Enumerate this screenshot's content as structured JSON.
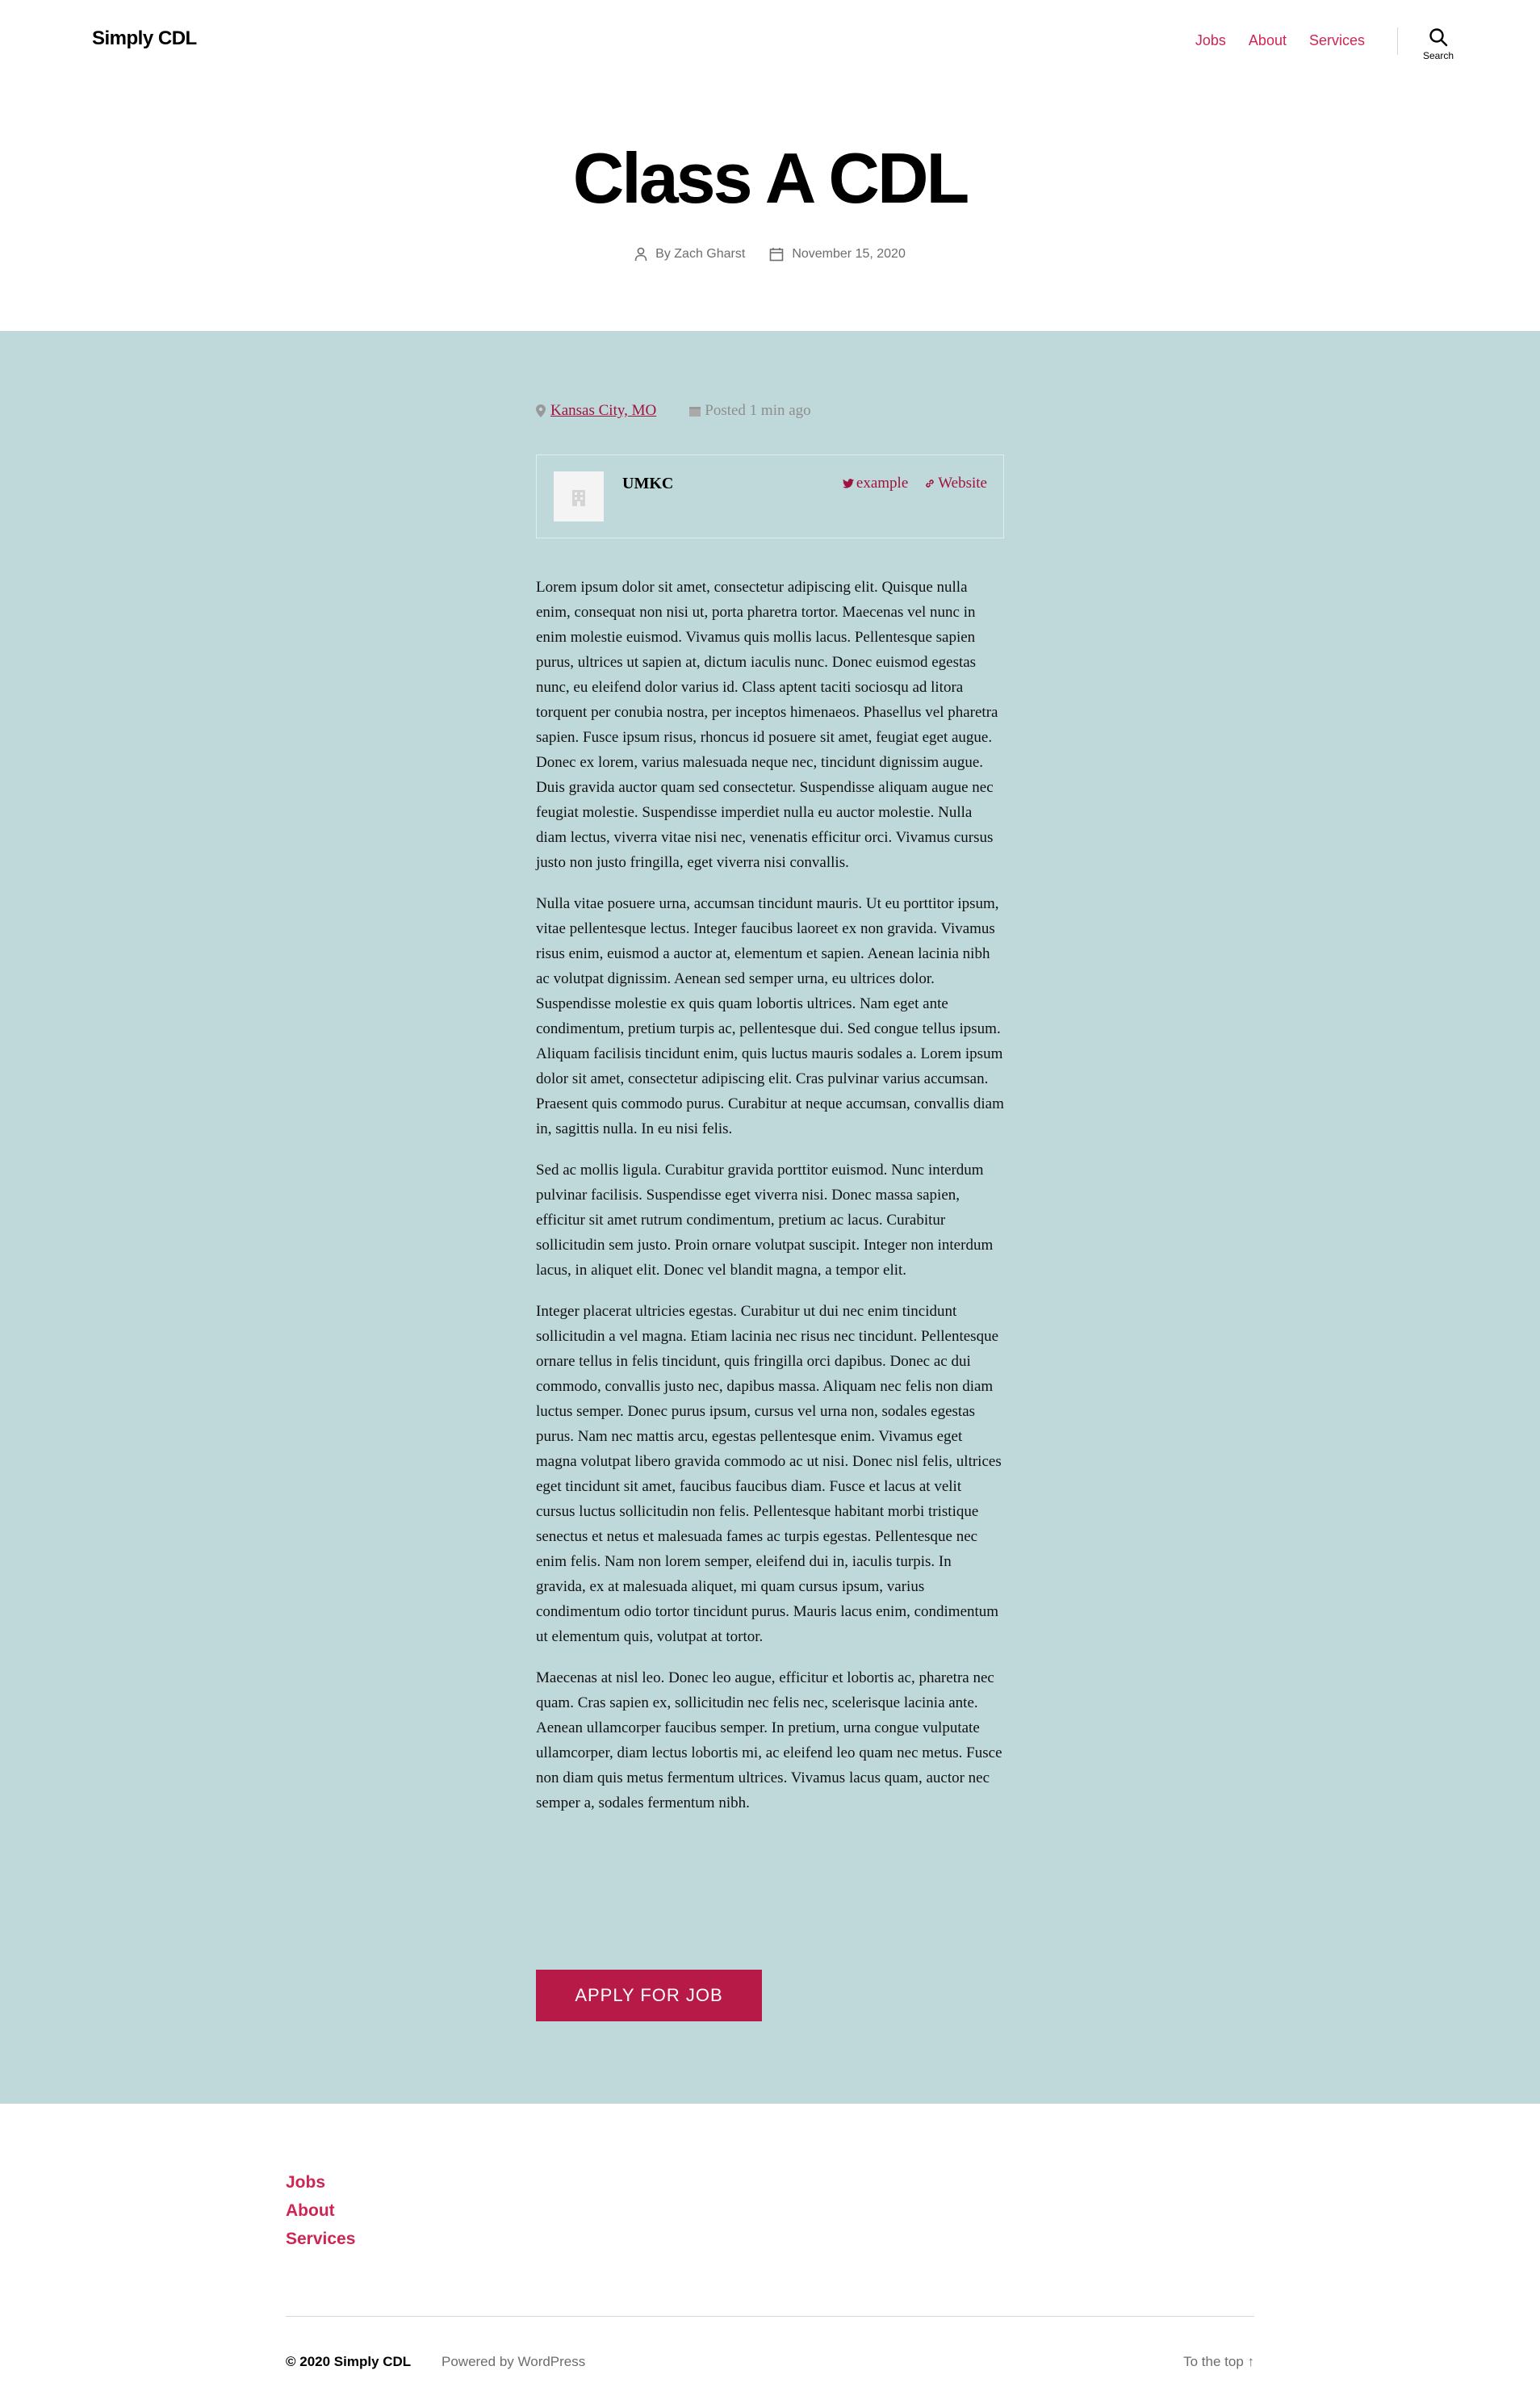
{
  "header": {
    "site_title": "Simply CDL",
    "nav": [
      "Jobs",
      "About",
      "Services"
    ],
    "search_label": "Search"
  },
  "post": {
    "title": "Class A CDL",
    "author": "By Zach Gharst",
    "date": "November 15, 2020"
  },
  "job": {
    "location": "Kansas City, MO",
    "posted": "Posted 1 min ago",
    "company": {
      "name": "UMKC",
      "twitter": "example",
      "website": "Website"
    },
    "description": [
      "Lorem ipsum dolor sit amet, consectetur adipiscing elit. Quisque nulla enim, consequat non nisi ut, porta pharetra tortor. Maecenas vel nunc in enim molestie euismod. Vivamus quis mollis lacus. Pellentesque sapien purus, ultrices ut sapien at, dictum iaculis nunc. Donec euismod egestas nunc, eu eleifend dolor varius id. Class aptent taciti sociosqu ad litora torquent per conubia nostra, per inceptos himenaeos. Phasellus vel pharetra sapien. Fusce ipsum risus, rhoncus id posuere sit amet, feugiat eget augue. Donec ex lorem, varius malesuada neque nec, tincidunt dignissim augue. Duis gravida auctor quam sed consectetur. Suspendisse aliquam augue nec feugiat molestie. Suspendisse imperdiet nulla eu auctor molestie. Nulla diam lectus, viverra vitae nisi nec, venenatis efficitur orci. Vivamus cursus justo non justo fringilla, eget viverra nisi convallis.",
      "Nulla vitae posuere urna, accumsan tincidunt mauris. Ut eu porttitor ipsum, vitae pellentesque lectus. Integer faucibus laoreet ex non gravida. Vivamus risus enim, euismod a auctor at, elementum et sapien. Aenean lacinia nibh ac volutpat dignissim. Aenean sed semper urna, eu ultrices dolor. Suspendisse molestie ex quis quam lobortis ultrices. Nam eget ante condimentum, pretium turpis ac, pellentesque dui. Sed congue tellus ipsum. Aliquam facilisis tincidunt enim, quis luctus mauris sodales a. Lorem ipsum dolor sit amet, consectetur adipiscing elit. Cras pulvinar varius accumsan. Praesent quis commodo purus. Curabitur at neque accumsan, convallis diam in, sagittis nulla. In eu nisi felis.",
      "Sed ac mollis ligula. Curabitur gravida porttitor euismod. Nunc interdum pulvinar facilisis. Suspendisse eget viverra nisi. Donec massa sapien, efficitur sit amet rutrum condimentum, pretium ac lacus. Curabitur sollicitudin sem justo. Proin ornare volutpat suscipit. Integer non interdum lacus, in aliquet elit. Donec vel blandit magna, a tempor elit.",
      "Integer placerat ultricies egestas. Curabitur ut dui nec enim tincidunt sollicitudin a vel magna. Etiam lacinia nec risus nec tincidunt. Pellentesque ornare tellus in felis tincidunt, quis fringilla orci dapibus. Donec ac dui commodo, convallis justo nec, dapibus massa. Aliquam nec felis non diam luctus semper. Donec purus ipsum, cursus vel urna non, sodales egestas purus. Nam nec mattis arcu, egestas pellentesque enim. Vivamus eget magna volutpat libero gravida commodo ac ut nisi. Donec nisl felis, ultrices eget tincidunt sit amet, faucibus faucibus diam. Fusce et lacus at velit cursus luctus sollicitudin non felis. Pellentesque habitant morbi tristique senectus et netus et malesuada fames ac turpis egestas. Pellentesque nec enim felis. Nam non lorem semper, eleifend dui in, iaculis turpis. In gravida, ex at malesuada aliquet, mi quam cursus ipsum, varius condimentum odio tortor tincidunt purus. Mauris lacus enim, condimentum ut elementum quis, volutpat at tortor.",
      "Maecenas at nisl leo. Donec leo augue, efficitur et lobortis ac, pharetra nec quam. Cras sapien ex, sollicitudin nec felis nec, scelerisque lacinia ante. Aenean ullamcorper faucibus semper. In pretium, urna congue vulputate ullamcorper, diam lectus lobortis mi, ac eleifend leo quam nec metus. Fusce non diam quis metus fermentum ultrices. Vivamus lacus quam, auctor nec semper a, sodales fermentum nibh."
    ],
    "apply_label": "APPLY FOR JOB"
  },
  "footer": {
    "menu": [
      "Jobs",
      "About",
      "Services"
    ],
    "copyright": "© 2020 Simply CDL",
    "powered": "Powered by WordPress",
    "to_top": "To the top ↑"
  },
  "colors": {
    "accent": "#cd2653",
    "band": "#bfd9db",
    "button": "#b71a47"
  }
}
